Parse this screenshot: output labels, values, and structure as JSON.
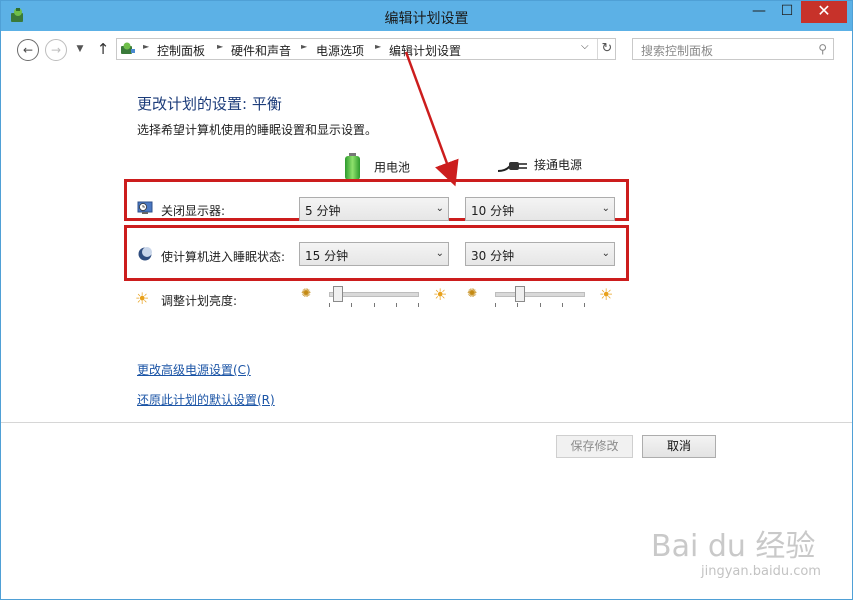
{
  "window": {
    "title": "编辑计划设置",
    "min_glyph": "—",
    "max_glyph": "☐",
    "close_glyph": "✕"
  },
  "nav": {
    "back_glyph": "←",
    "forward_glyph": "→",
    "history_glyph": "▼",
    "up_glyph": "↑"
  },
  "breadcrumb": [
    "控制面板",
    "硬件和声音",
    "电源选项",
    "编辑计划设置"
  ],
  "breadcrumb_sep": "►",
  "address": {
    "dropdown_glyph": "⌵",
    "refresh_glyph": "↻"
  },
  "search": {
    "placeholder": "搜索控制面板",
    "icon_glyph": "⚲"
  },
  "main": {
    "heading": "更改计划的设置: 平衡",
    "subtitle": "选择希望计算机使用的睡眠设置和显示设置。",
    "col_battery": "用电池",
    "col_plugged": "接通电源"
  },
  "rows": {
    "display_label": "关闭显示器:",
    "display_battery": "5 分钟",
    "display_plugged": "10 分钟",
    "sleep_label": "使计算机进入睡眠状态:",
    "sleep_battery": "15 分钟",
    "sleep_plugged": "30 分钟",
    "brightness_label": "调整计划亮度:",
    "brightness_battery_level": 0.05,
    "brightness_plugged_level": 0.25,
    "caret_glyph": "⌄"
  },
  "links": {
    "advanced": "更改高级电源设置(C)",
    "restore": "还原此计划的默认设置(R)"
  },
  "buttons": {
    "save": "保存修改",
    "cancel": "取消"
  },
  "watermark": {
    "brand": "Bai du 经验",
    "url": "jingyan.baidu.com"
  },
  "colors": {
    "titlebar": "#5cb1e6",
    "highlight": "#cc1d1d",
    "link": "#1c55a6",
    "heading": "#1c3c7a"
  }
}
